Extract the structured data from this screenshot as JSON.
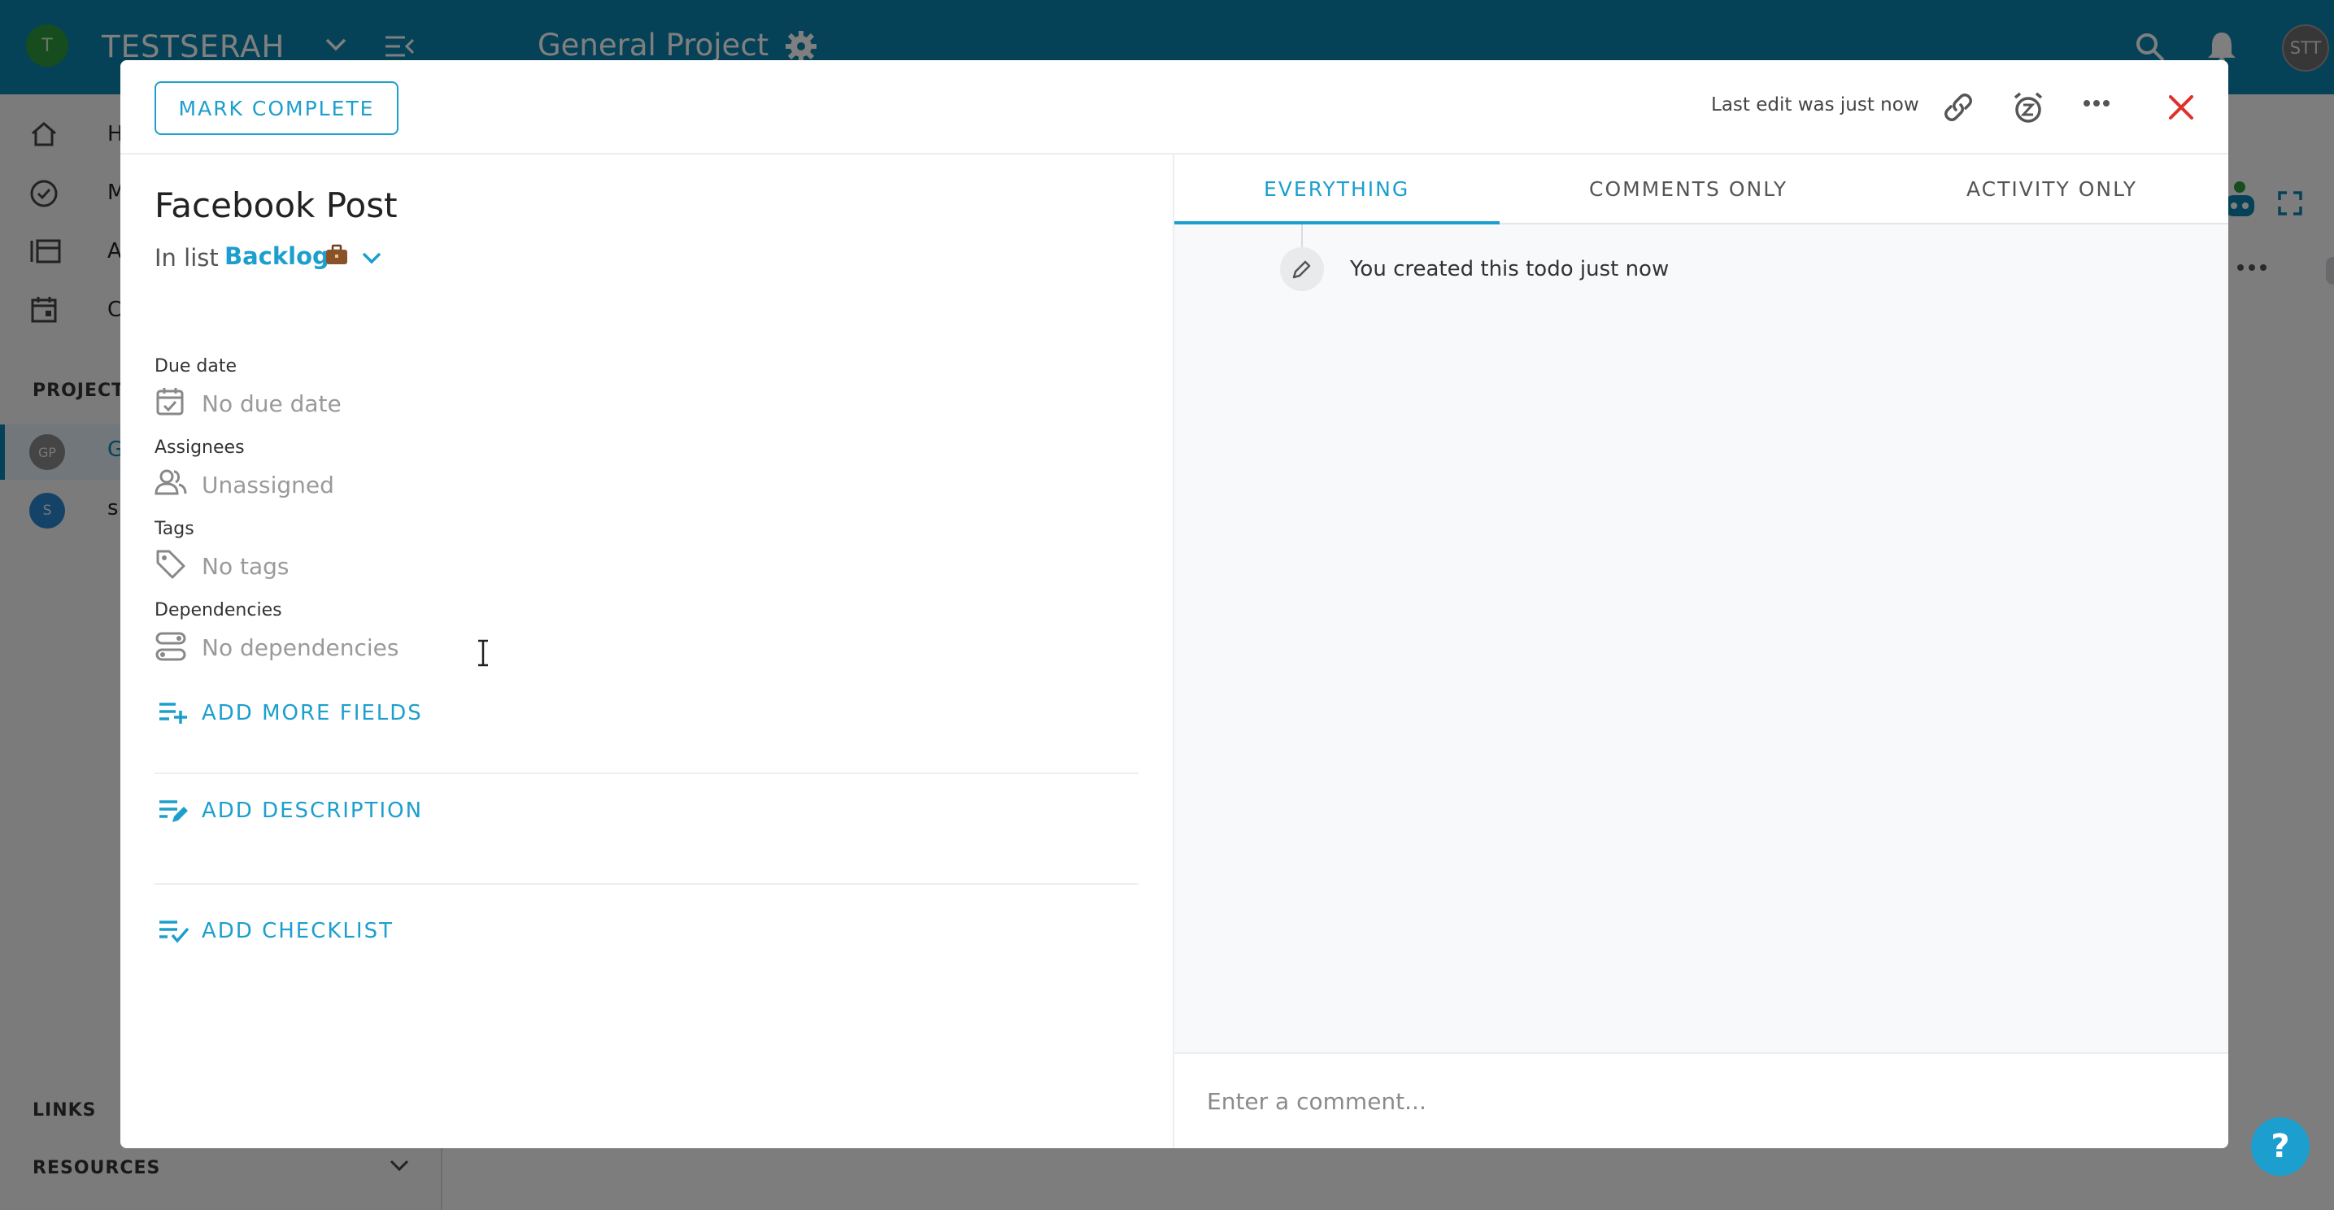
{
  "app": {
    "workspace_initial": "T",
    "workspace_name": "TESTSERAH",
    "project_title": "General Project",
    "user_initials": "STT"
  },
  "sidebar": {
    "items": [
      {
        "label": "H",
        "icon": "home-icon"
      },
      {
        "label": "M",
        "icon": "check-circle-icon"
      },
      {
        "label": "A",
        "icon": "activity-list-icon"
      },
      {
        "label": "C",
        "icon": "calendar-icon"
      }
    ],
    "projects_label": "PROJECTS",
    "projects": [
      {
        "initials": "GP",
        "label": "G"
      },
      {
        "initials": "S",
        "label": "s"
      }
    ],
    "links_label": "LINKS",
    "resources_label": "RESOURCES"
  },
  "modal": {
    "mark_complete_label": "MARK COMPLETE",
    "last_edit": "Last edit was just now",
    "task_title": "Facebook Post",
    "in_list_prefix": "In list",
    "list_name": "Backlog",
    "fields": {
      "due_date_label": "Due date",
      "due_date_value": "No due date",
      "assignees_label": "Assignees",
      "assignees_value": "Unassigned",
      "tags_label": "Tags",
      "tags_value": "No tags",
      "dependencies_label": "Dependencies",
      "dependencies_value": "No dependencies"
    },
    "add_more_fields": "ADD MORE FIELDS",
    "add_description": "ADD DESCRIPTION",
    "add_checklist": "ADD CHECKLIST",
    "tabs": [
      "EVERYTHING",
      "COMMENTS ONLY",
      "ACTIVITY ONLY"
    ],
    "active_tab": "EVERYTHING",
    "activity": [
      "You created this todo just now"
    ],
    "comment_placeholder": "Enter a comment..."
  },
  "help_label": "?",
  "colors": {
    "brand": "#0c84ae",
    "accent": "#1c9fce",
    "close": "#e0302a"
  }
}
